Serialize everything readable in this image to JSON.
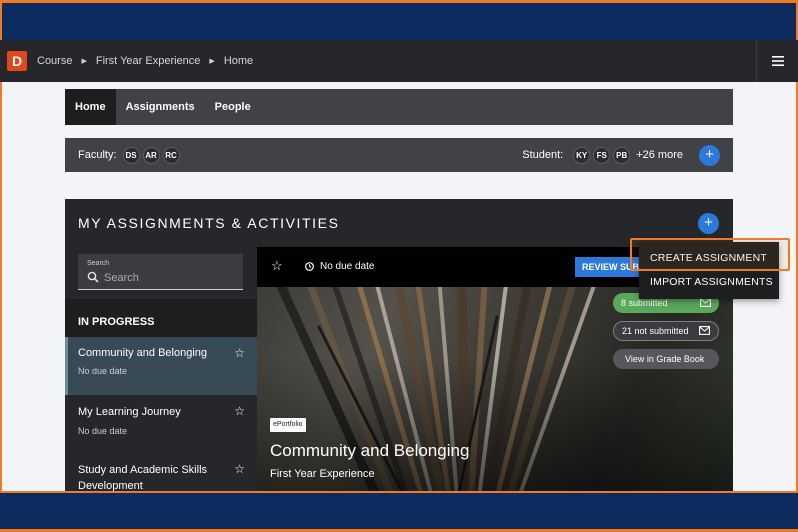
{
  "topbar": {
    "logo_letter": "D",
    "breadcrumbs": [
      "Course",
      "First Year Experience",
      "Home"
    ],
    "menu_icon": "hamburger-icon"
  },
  "tabs": [
    {
      "label": "Home",
      "active": true
    },
    {
      "label": "Assignments",
      "active": false
    },
    {
      "label": "People",
      "active": false
    }
  ],
  "people": {
    "faculty_label": "Faculty:",
    "faculty": [
      "DS",
      "AR",
      "RC"
    ],
    "student_label": "Student:",
    "students": [
      "KY",
      "FS",
      "PB"
    ],
    "more_students": "+26 more",
    "add_icon": "+"
  },
  "assignments": {
    "title": "MY ASSIGNMENTS & ACTIVITIES",
    "add_icon": "+",
    "search": {
      "label": "Search",
      "placeholder": "Search"
    },
    "section": "IN PROGRESS",
    "items": [
      {
        "title": "Community and Belonging",
        "due": "No due date",
        "active": true
      },
      {
        "title": "My Learning Journey",
        "due": "No due date",
        "active": false
      },
      {
        "title": "Study and Academic Skills",
        "title2": "Development",
        "active": false
      }
    ]
  },
  "detail": {
    "star": "☆",
    "due": "No due date",
    "review_button": "REVIEW SUBMISSIONS",
    "submitted": "8 submitted",
    "not_submitted": "21 not submitted",
    "gradebook": "View in Grade Book",
    "badge": "ePortfolio",
    "title": "Community and Belonging",
    "subtitle": "First Year Experience"
  },
  "dropdown": {
    "items": [
      "CREATE ASSIGNMENT",
      "IMPORT ASSIGNMENTS"
    ]
  },
  "colors": {
    "frame": "#0c2b5e",
    "frame_accent": "#f07b22",
    "primary": "#2c79dc",
    "success": "#5aa85b"
  }
}
